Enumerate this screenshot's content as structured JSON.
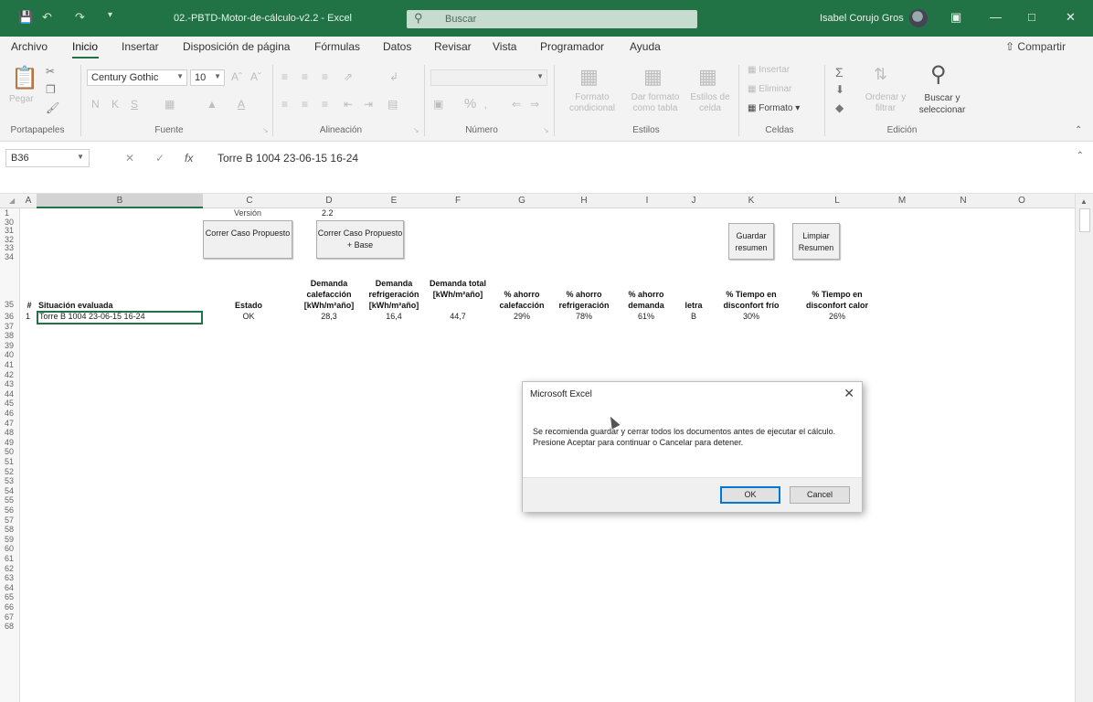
{
  "window": {
    "title": "02.-PBTD-Motor-de-cálculo-v2.2  -  Excel",
    "search_placeholder": "Buscar",
    "user_name": "Isabel Corujo Gros",
    "share_label": "Compartir"
  },
  "ribbon": {
    "tabs": [
      "Archivo",
      "Inicio",
      "Insertar",
      "Disposición de página",
      "Fórmulas",
      "Datos",
      "Revisar",
      "Vista",
      "Programador",
      "Ayuda"
    ],
    "active_tab": "Inicio",
    "font_name": "Century Gothic",
    "font_size": "10",
    "paste_label": "Pegar",
    "bold": "N",
    "italic": "K",
    "underline": "S",
    "percent": "%",
    "conditional_format": "Formato condicional",
    "format_as_table": "Dar formato como tabla",
    "cell_styles": "Estilos de celda",
    "insert": "Insertar",
    "delete": "Eliminar",
    "format": "Formato",
    "sort_filter": "Ordenar y filtrar",
    "find_select": "Buscar y seleccionar",
    "groups": [
      "Portapapeles",
      "Fuente",
      "Alineación",
      "Número",
      "Estilos",
      "Celdas",
      "Edición"
    ]
  },
  "formula_bar": {
    "name_box": "B36",
    "content": "Torre B 1004  23-06-15 16-24"
  },
  "sheet": {
    "columns": [
      "A",
      "B",
      "C",
      "D",
      "E",
      "F",
      "G",
      "H",
      "I",
      "J",
      "K",
      "L",
      "M",
      "N",
      "O"
    ],
    "rows": [
      "1",
      "30",
      "31",
      "32",
      "33",
      "34",
      "35",
      "36",
      "37",
      "38",
      "39",
      "40",
      "41",
      "42",
      "43",
      "44",
      "45",
      "46",
      "47",
      "48",
      "49",
      "50",
      "51",
      "52",
      "53",
      "54",
      "55",
      "56",
      "57",
      "58",
      "59",
      "60",
      "61",
      "62",
      "63",
      "64",
      "65",
      "66",
      "67",
      "68"
    ],
    "version_label": "Versión",
    "version_value": "2.2",
    "buttons": {
      "run_proposed": "Correr Caso Propuesto",
      "run_proposed_base": "Correr Caso Propuesto + Base",
      "save_summary": "Guardar resumen",
      "clear_summary": "Limpiar Resumen"
    },
    "headers": {
      "num": "#",
      "situation": "Situación evaluada",
      "status": "Estado",
      "heating": "Demanda calefacción [kWh/m²año]",
      "cooling": "Demanda refrigeración [kWh/m²año]",
      "total": "Demanda total [kWh/m²año]",
      "save_heating": "% ahorro calefacción",
      "save_cooling": "% ahorro refrigeración",
      "save_demand": "% ahorro demanda",
      "letter": "letra",
      "cold_time": "% Tiempo en disconfort frío",
      "hot_time": "% Tiempo en disconfort calor"
    },
    "row36": {
      "num": "1",
      "situation": "Torre B 1004  23-06-15 16-24",
      "status": "OK",
      "heating": "28,3",
      "cooling": "16,4",
      "total": "44,7",
      "save_heating": "29%",
      "save_cooling": "78%",
      "save_demand": "61%",
      "letter": "B",
      "cold_time": "30%",
      "hot_time": "26%"
    }
  },
  "dialog": {
    "title": "Microsoft Excel",
    "message_1": "Se recomienda guardar y cerrar todos los documentos antes de ejecutar el cálculo.",
    "message_2": "Presione Aceptar para continuar o Cancelar para detener.",
    "ok": "OK",
    "cancel": "Cancel"
  },
  "colors": {
    "excel_green": "#217346",
    "dialog_default_border": "#0078d7"
  }
}
